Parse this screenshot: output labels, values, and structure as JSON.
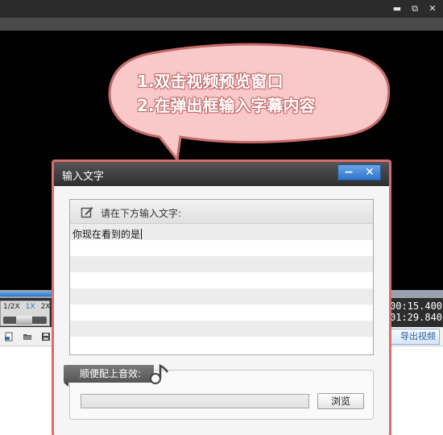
{
  "window": {
    "controls": [
      "▬",
      "⧉",
      "✕"
    ]
  },
  "bubble": {
    "line1": "1.双击视频预览窗口",
    "line2": "2.在弹出框输入字幕内容"
  },
  "player": {
    "progress_fraction": 0.88,
    "speed_options": [
      "1/2X",
      "1X",
      "2X"
    ],
    "active_speed": "1X",
    "time_current": "00:15.400",
    "time_total": "01:29.840"
  },
  "toolbar": {
    "icons": [
      "new-file-icon",
      "open-folder-icon",
      "save-icon"
    ],
    "export_label": "导出视频"
  },
  "dialog": {
    "title": "输入文字",
    "minimize": "−",
    "close": "✕",
    "text_section_label": "请在下方输入文字:",
    "typed_text": "你现在看到的是",
    "sound_section_label": "顺便配上音效:",
    "file_value": "",
    "browse_label": "浏览"
  },
  "colors": {
    "bubble_fill": "#f9c8c8",
    "bubble_border": "#c46a6a",
    "dialog_border": "#d96e6e",
    "accent_blue": "#2f76c8"
  }
}
